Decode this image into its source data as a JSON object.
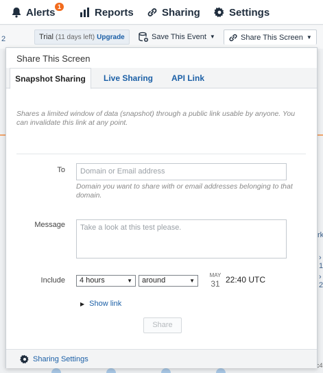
{
  "nav": {
    "alerts_label": "Alerts",
    "alerts_badge": "1",
    "reports_label": "Reports",
    "sharing_label": "Sharing",
    "settings_label": "Settings"
  },
  "toolbar": {
    "trial_label": "Trial",
    "trial_days": "(11 days left)",
    "upgrade_label": "Upgrade",
    "save_event_label": "Save This Event",
    "share_screen_label": "Share This Screen"
  },
  "background": {
    "fragment_left": "2",
    "fragment_right1": "rk",
    "fragment_right2": "› 1",
    "fragment_right3": "› 2",
    "fragment_bottom": "c4"
  },
  "dialog": {
    "title": "Share This Screen",
    "tabs": [
      {
        "label": "Snapshot Sharing",
        "active": true
      },
      {
        "label": "Live Sharing",
        "active": false
      },
      {
        "label": "API Link",
        "active": false
      }
    ],
    "description": "Shares a limited window of data (snapshot) through a public link usable by anyone. You can invalidate this link at any point.",
    "to_label": "To",
    "to_placeholder": "Domain or Email address",
    "to_hint": "Domain you want to share with or email addresses belonging to that domain.",
    "message_label": "Message",
    "message_placeholder": "Take a look at this test please.",
    "include_label": "Include",
    "duration_selected": "4 hours",
    "position_selected": "around",
    "date_month": "MAY",
    "date_day": "31",
    "time": "22:40 UTC",
    "show_link_label": "Show link",
    "share_button_label": "Share",
    "footer_settings_label": "Sharing Settings"
  },
  "colors": {
    "link": "#1b5fa6",
    "badge": "#f26b1d",
    "accent_line": "#f0a46a"
  }
}
